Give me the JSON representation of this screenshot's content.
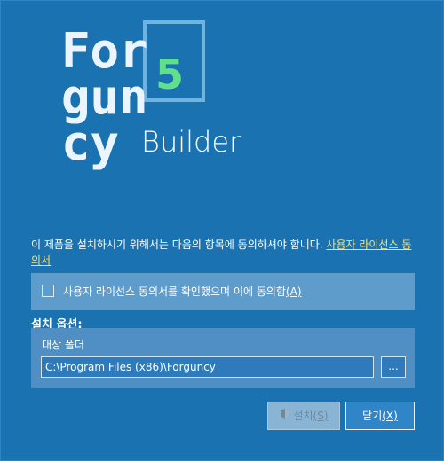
{
  "logo": {
    "letters": [
      "For",
      "gun",
      "cy"
    ],
    "version": "5",
    "product": "Builder",
    "colors": {
      "grid": "#eaf5ff",
      "badge_border": "#6fb3e0",
      "badge_number": "#5fe08a"
    }
  },
  "notice": {
    "text": "이 제품을 설치하시기 위해서는 다음의 항목에 동의하셔야 합니다. ",
    "link": "사용자 라이선스 동의서"
  },
  "agreement": {
    "checked": false,
    "label": "사용자 라이선스 동의서를 확인했으며 이에 동의함",
    "accesskey": "(A)"
  },
  "options": {
    "title": "설치 옵션:",
    "folder_label": "대상 폴더",
    "folder_value": "C:\\Program Files (x86)\\Forguncy",
    "browse_label": "..."
  },
  "buttons": {
    "install": "설치",
    "install_key": "(S)",
    "close": "닫기",
    "close_key": "(X)"
  },
  "colors": {
    "background": "#1b72b0",
    "link": "#ffe06a",
    "panel": "#5e9ccc"
  }
}
